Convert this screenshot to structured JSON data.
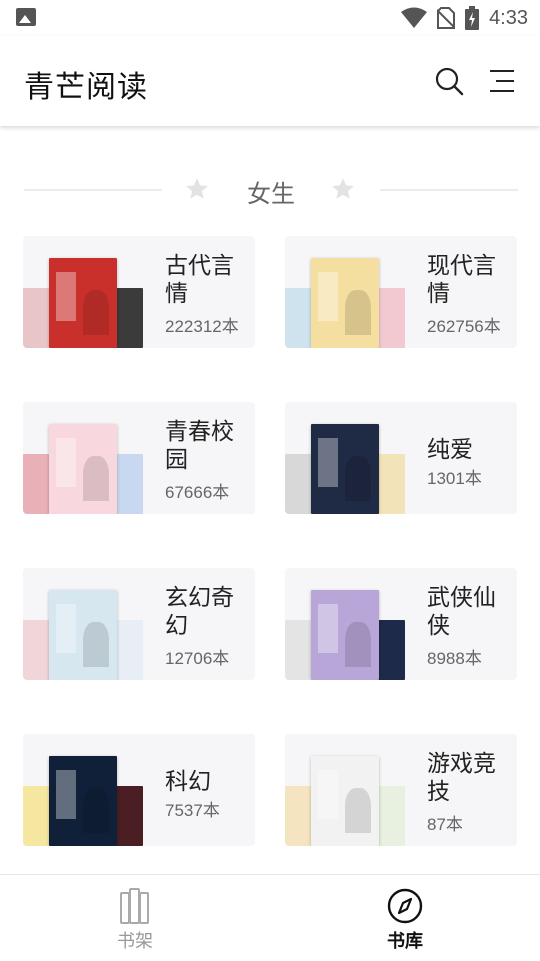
{
  "status_bar": {
    "time": "4:33",
    "icons": [
      "gallery-icon",
      "wifi-icon",
      "no-sim-icon",
      "battery-charging-icon"
    ]
  },
  "app_bar": {
    "title": "青芒阅读",
    "icons": [
      "search-icon",
      "menu-icon"
    ]
  },
  "section": {
    "title": "女生",
    "icons": [
      "star-icon",
      "star-icon"
    ]
  },
  "categories": [
    {
      "name": "古代言情",
      "count": "222312本",
      "colors": {
        "front": "#c9302c",
        "left": "#e8c6c8",
        "right": "#3b3b3b"
      }
    },
    {
      "name": "现代言情",
      "count": "262756本",
      "colors": {
        "front": "#f4dfa0",
        "left": "#cfe3ee",
        "right": "#f2c9d0"
      }
    },
    {
      "name": "青春校园",
      "count": "67666本",
      "colors": {
        "front": "#f8d8de",
        "left": "#e9b0b8",
        "right": "#c8d8f0"
      }
    },
    {
      "name": "纯爱",
      "count": "1301本",
      "colors": {
        "front": "#1f2a44",
        "left": "#d8d8d8",
        "right": "#f3e3b8"
      }
    },
    {
      "name": "玄幻奇幻",
      "count": "12706本",
      "colors": {
        "front": "#d6e7f0",
        "left": "#f0d6d8",
        "right": "#e8eef6"
      }
    },
    {
      "name": "武侠仙侠",
      "count": "8988本",
      "colors": {
        "front": "#b8a6d8",
        "left": "#e4e4e4",
        "right": "#1d2a4a"
      }
    },
    {
      "name": "科幻",
      "count": "7537本",
      "colors": {
        "front": "#0f2038",
        "left": "#f5e6a0",
        "right": "#4a1e22"
      }
    },
    {
      "name": "游戏竞技",
      "count": "87本",
      "colors": {
        "front": "#f2f2f2",
        "left": "#f5e4c0",
        "right": "#e8f0e0"
      }
    }
  ],
  "bottom_nav": [
    {
      "label": "书架",
      "icon": "bookshelf-icon",
      "active": false
    },
    {
      "label": "书库",
      "icon": "compass-icon",
      "active": true
    }
  ]
}
